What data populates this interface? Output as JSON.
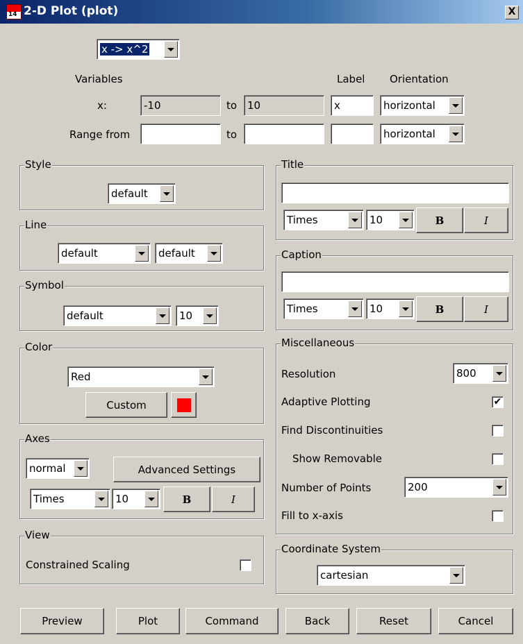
{
  "window": {
    "title": "2-D Plot (plot)",
    "close_label": "X"
  },
  "expression": {
    "value": "x -> x^2"
  },
  "variables": {
    "header": "Variables",
    "label_header": "Label",
    "orientation_header": "Orientation",
    "x_label": "x:",
    "x_from": "-10",
    "to1": "to",
    "x_to": "10",
    "x_label_value": "x",
    "x_orientation": "horizontal",
    "range_label": "Range from",
    "range_from": "",
    "to2": "to",
    "range_to": "",
    "range_label_value": "",
    "range_orientation": "horizontal"
  },
  "style": {
    "title": "Style",
    "value": "default"
  },
  "line": {
    "title": "Line",
    "value1": "default",
    "value2": "default"
  },
  "symbol": {
    "title": "Symbol",
    "value": "default",
    "size": "10"
  },
  "color": {
    "title": "Color",
    "value": "Red",
    "custom_label": "Custom",
    "swatch": "#ff0000"
  },
  "axes": {
    "title": "Axes",
    "mode": "normal",
    "advanced_label": "Advanced Settings",
    "font": "Times",
    "size": "10",
    "bold": "B",
    "italic": "I"
  },
  "view": {
    "title": "View",
    "constrained_label": "Constrained Scaling",
    "constrained_checked": false
  },
  "title_group": {
    "title": "Title",
    "text": "",
    "font": "Times",
    "size": "10",
    "bold": "B",
    "italic": "I"
  },
  "caption_group": {
    "title": "Caption",
    "text": "",
    "font": "Times",
    "size": "10",
    "bold": "B",
    "italic": "I"
  },
  "misc": {
    "title": "Miscellaneous",
    "resolution_label": "Resolution",
    "resolution": "800",
    "adaptive_label": "Adaptive Plotting",
    "adaptive_mark": "✔",
    "discont_label": "Find Discontinuities",
    "removable_label": "Show Removable",
    "points_label": "Number of Points",
    "points": "200",
    "fill_label": "Fill to x-axis"
  },
  "coords": {
    "title": "Coordinate System",
    "value": "cartesian"
  },
  "buttons": {
    "preview": "Preview",
    "plot": "Plot",
    "command": "Command",
    "back": "Back",
    "reset": "Reset",
    "cancel": "Cancel"
  }
}
